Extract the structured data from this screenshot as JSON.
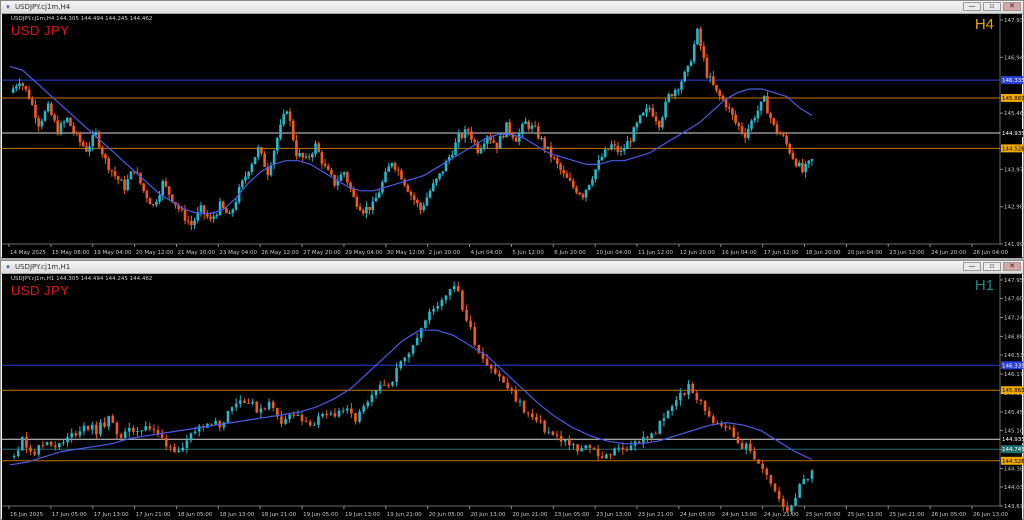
{
  "charts": [
    {
      "window_title": "USDJPY.cj1m,H4",
      "ohlc_line": "USDJPY.cj1m,H4  144.305 144.494 144.245 144.462",
      "symbol_label": "USD JPY",
      "timeframe_label": "H4",
      "timeframe_color": "#e8a300",
      "price_min": 141.99,
      "price_max": 147.93,
      "price_ticks": [
        "147.930",
        "146.940",
        "145.460",
        "143.970",
        "142.980",
        "141.990"
      ],
      "hlines": [
        {
          "price": 146.335,
          "color": "#2b3fd6",
          "label": "146.335",
          "label_bg": "#2b3fd6",
          "label_fg": "#ffffff"
        },
        {
          "price": 145.863,
          "color": "#c87400",
          "label": "145.863",
          "label_bg": "#f0a800",
          "label_fg": "#000000"
        },
        {
          "price": 144.935,
          "color": "#d8d8d8",
          "label": "144.935",
          "label_bg": "#000000",
          "label_fg": "#ffffff"
        },
        {
          "price": 144.526,
          "color": "#c87400",
          "label": "144.526",
          "label_bg": "#f0a800",
          "label_fg": "#000000"
        }
      ],
      "time_labels": [
        "14 May 2025",
        "15 May 08:00",
        "19 May 04:00",
        "20 May 12:00",
        "21 May 20:00",
        "23 May 04:00",
        "26 May 12:00",
        "27 May 20:00",
        "29 May 04:00",
        "30 May 12:00",
        "2 Jun 20:00",
        "4 Jun 04:00",
        "5 Jun 12:00",
        "6 Jun 20:00",
        "10 Jun 04:00",
        "11 Jun 12:00",
        "12 Jun 20:00",
        "16 Jun 04:00",
        "17 Jun 12:00",
        "18 Jun 20:00",
        "20 Jun 04:00",
        "23 Jun 12:00",
        "24 Jun 20:00",
        "26 Jun 04:00"
      ],
      "close_path": [
        146.0,
        146.35,
        145.9,
        145.2,
        145.6,
        145.0,
        145.3,
        144.8,
        144.5,
        144.9,
        144.2,
        143.8,
        143.5,
        144.0,
        143.4,
        143.0,
        143.6,
        143.2,
        142.8,
        142.5,
        142.9,
        142.6,
        143.0,
        142.7,
        143.4,
        144.0,
        144.5,
        143.9,
        144.8,
        145.6,
        144.4,
        144.2,
        144.6,
        144.0,
        143.6,
        143.9,
        143.2,
        142.9,
        143.0,
        143.6,
        144.2,
        143.8,
        143.3,
        142.9,
        143.4,
        143.8,
        144.3,
        144.8,
        145.0,
        144.5,
        144.9,
        144.6,
        145.1,
        144.8,
        145.2,
        145.0,
        144.6,
        144.2,
        143.8,
        143.5,
        143.3,
        143.8,
        144.3,
        144.6,
        144.4,
        144.8,
        145.3,
        145.6,
        145.2,
        145.9,
        146.2,
        146.6,
        147.6,
        146.5,
        146.0,
        145.7,
        145.2,
        144.9,
        145.4,
        145.8,
        145.1,
        144.8,
        144.3,
        143.9,
        144.2
      ],
      "ma_path": [
        146.7,
        146.6,
        146.3,
        146.0,
        145.7,
        145.4,
        145.1,
        144.8,
        144.5,
        144.2,
        143.9,
        143.6,
        143.3,
        143.1,
        142.9,
        142.8,
        142.8,
        142.9,
        143.2,
        143.6,
        143.9,
        144.1,
        144.2,
        144.2,
        144.1,
        143.9,
        143.7,
        143.5,
        143.4,
        143.4,
        143.5,
        143.6,
        143.7,
        143.8,
        144.0,
        144.2,
        144.4,
        144.6,
        144.8,
        144.9,
        144.9,
        144.8,
        144.6,
        144.4,
        144.3,
        144.2,
        144.1,
        144.1,
        144.2,
        144.2,
        144.3,
        144.4,
        144.6,
        144.8,
        145.0,
        145.2,
        145.5,
        145.8,
        146.0,
        146.1,
        146.1,
        146.0,
        145.9,
        145.6,
        145.4
      ]
    },
    {
      "window_title": "USDJPY.cj1m,H1",
      "ohlc_line": "USDJPY.cj1m,H1  144.305 144.494 144.245 144.462",
      "symbol_label": "USD JPY",
      "timeframe_label": "H1",
      "timeframe_color": "#1f8a8a",
      "price_min": 143.67,
      "price_max": 147.95,
      "price_ticks": [
        "147.950",
        "147.600",
        "147.240",
        "146.880",
        "146.530",
        "146.170",
        "145.810",
        "145.450",
        "145.100",
        "144.740",
        "144.380",
        "144.030",
        "143.670"
      ],
      "hlines": [
        {
          "price": 146.335,
          "color": "#2b3fd6",
          "label": "146.335",
          "label_bg": "#2b3fd6",
          "label_fg": "#ffffff"
        },
        {
          "price": 145.863,
          "color": "#c87400",
          "label": "145.863",
          "label_bg": "#f0a800",
          "label_fg": "#000000"
        },
        {
          "price": 144.935,
          "color": "#d8d8d8",
          "label": "144.935",
          "label_bg": "#000000",
          "label_fg": "#ffffff"
        },
        {
          "price": 144.745,
          "color": "#1f6f6f",
          "label": "144.745",
          "label_bg": "#1f6f6f",
          "label_fg": "#ffffff"
        },
        {
          "price": 144.526,
          "color": "#c87400",
          "label": "144.526",
          "label_bg": "#f0a800",
          "label_fg": "#000000"
        }
      ],
      "time_labels": [
        "16 Jun 2025",
        "17 Jun 05:00",
        "17 Jun 13:00",
        "17 Jun 21:00",
        "18 Jun 05:00",
        "18 Jun 13:00",
        "18 Jun 21:00",
        "19 Jun 05:00",
        "19 Jun 13:00",
        "19 Jun 21:00",
        "20 Jun 05:00",
        "20 Jun 13:00",
        "20 Jun 21:00",
        "23 Jun 05:00",
        "23 Jun 13:00",
        "23 Jun 21:00",
        "24 Jun 05:00",
        "24 Jun 13:00",
        "24 Jun 21:00",
        "25 Jun 05:00",
        "25 Jun 13:00",
        "25 Jun 21:00",
        "26 Jun 05:00",
        "26 Jun 13:00"
      ],
      "close_path": [
        144.6,
        144.9,
        144.7,
        144.9,
        144.8,
        145.0,
        145.2,
        145.1,
        145.3,
        145.0,
        145.1,
        145.2,
        145.0,
        144.8,
        144.7,
        145.1,
        145.3,
        145.2,
        145.6,
        145.7,
        145.5,
        145.6,
        145.3,
        145.4,
        145.2,
        145.3,
        145.4,
        145.5,
        145.3,
        145.6,
        145.9,
        146.1,
        146.5,
        146.9,
        147.3,
        147.6,
        147.9,
        147.2,
        146.6,
        146.3,
        146.0,
        145.7,
        145.4,
        145.2,
        145.0,
        144.9,
        144.7,
        144.8,
        144.6,
        144.7,
        144.8,
        144.9,
        145.0,
        145.3,
        145.7,
        145.9,
        145.6,
        145.3,
        145.2,
        144.9,
        144.7,
        144.4,
        143.9,
        143.6,
        144.0,
        144.4
      ],
      "ma_path": [
        144.45,
        144.5,
        144.6,
        144.7,
        144.75,
        144.8,
        144.85,
        144.95,
        145.0,
        145.05,
        145.1,
        145.15,
        145.2,
        145.25,
        145.3,
        145.35,
        145.4,
        145.45,
        145.55,
        145.7,
        145.9,
        146.2,
        146.5,
        146.8,
        147.0,
        147.0,
        146.9,
        146.7,
        146.5,
        146.2,
        145.9,
        145.6,
        145.35,
        145.15,
        145.0,
        144.9,
        144.85,
        144.85,
        144.9,
        145.0,
        145.1,
        145.2,
        145.25,
        145.2,
        145.1,
        144.9,
        144.7,
        144.55
      ]
    }
  ]
}
